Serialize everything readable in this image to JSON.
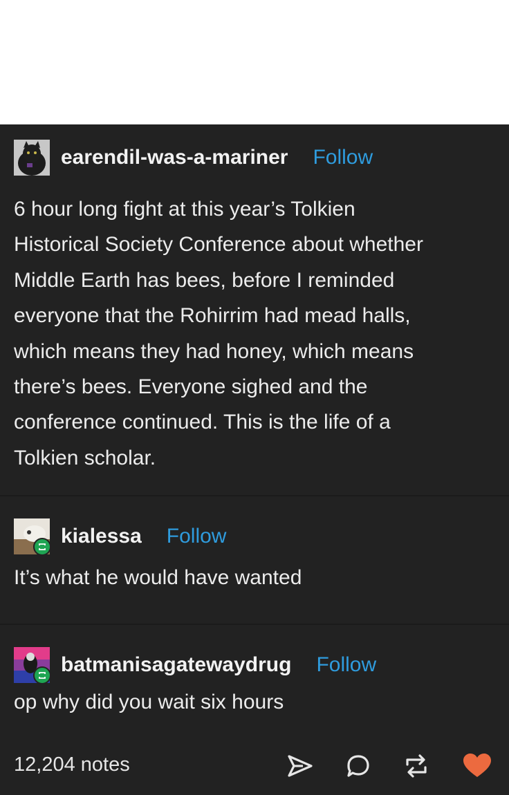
{
  "post": {
    "original": {
      "username": "earendil-was-a-mariner",
      "follow_label": "Follow",
      "lines": [
        "6 hour long fight at this year’s Tolkien",
        "Historical Society Conference about whether",
        "Middle Earth has bees, before I reminded",
        "everyone that the Rohirrim had mead halls,",
        "which means they had honey, which means",
        "there’s bees. Everyone sighed and the",
        "conference continued. This is the life of a",
        "Tolkien scholar."
      ]
    },
    "reblogs": [
      {
        "username": "kialessa",
        "follow_label": "Follow",
        "text": "It’s what he would have wanted"
      },
      {
        "username": "batmanisagatewaydrug",
        "follow_label": "Follow",
        "text": "op why did you wait six hours"
      }
    ],
    "footer": {
      "notes": "12,204 notes",
      "icons": [
        "share-icon",
        "reply-icon",
        "reblog-icon",
        "like-heart-icon"
      ],
      "like_color": "#ec6a3f"
    }
  },
  "colors": {
    "background": "#222222",
    "follow_link": "#2f9cde",
    "reblog_badge": "#1fa553"
  }
}
